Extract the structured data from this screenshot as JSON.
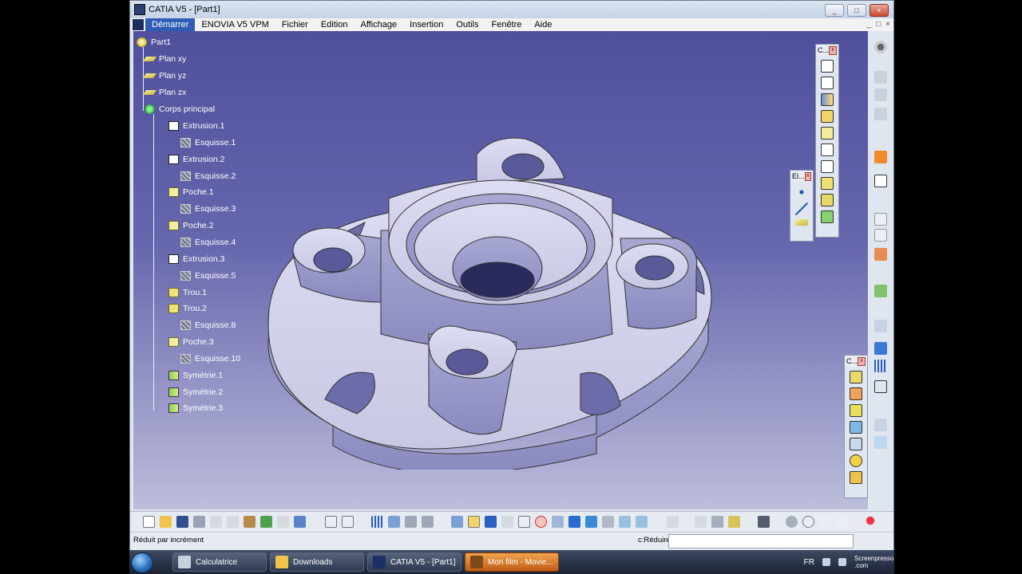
{
  "window": {
    "title": "CATIA V5 - [Part1]"
  },
  "menu": {
    "items": [
      "Démarrer",
      "ENOVIA V5 VPM",
      "Fichier",
      "Edition",
      "Affichage",
      "Insertion",
      "Outils",
      "Fenêtre",
      "Aide"
    ],
    "right_controls": [
      "_",
      "□",
      "×"
    ]
  },
  "tree": {
    "root": "Part1",
    "items": [
      {
        "label": "Plan xy",
        "icon": "plane-icon"
      },
      {
        "label": "Plan yz",
        "icon": "plane-icon"
      },
      {
        "label": "Plan zx",
        "icon": "plane-icon"
      },
      {
        "label": "Corps principal",
        "icon": "body-icon"
      },
      {
        "label": "Extrusion.1",
        "icon": "pad-icon"
      },
      {
        "label": "Esquisse.1",
        "icon": "sketch-icon"
      },
      {
        "label": "Extrusion.2",
        "icon": "pad-icon"
      },
      {
        "label": "Esquisse.2",
        "icon": "sketch-icon"
      },
      {
        "label": "Poche.1",
        "icon": "pocket-icon"
      },
      {
        "label": "Esquisse.3",
        "icon": "sketch-icon"
      },
      {
        "label": "Poche.2",
        "icon": "pocket-icon"
      },
      {
        "label": "Esquisse.4",
        "icon": "sketch-icon"
      },
      {
        "label": "Extrusion.3",
        "icon": "pad-icon"
      },
      {
        "label": "Esquisse.5",
        "icon": "sketch-icon"
      },
      {
        "label": "Trou.1",
        "icon": "hole-icon"
      },
      {
        "label": "Trou.2",
        "icon": "hole-icon"
      },
      {
        "label": "Esquisse.8",
        "icon": "sketch-icon"
      },
      {
        "label": "Poche.3",
        "icon": "pocket-icon"
      },
      {
        "label": "Esquisse.10",
        "icon": "sketch-icon"
      },
      {
        "label": "Symétrie.1",
        "icon": "symmetry-icon"
      },
      {
        "label": "Symétrie.2",
        "icon": "symmetry-icon"
      },
      {
        "label": "Symétrie.3",
        "icon": "symmetry-icon"
      }
    ]
  },
  "floating_toolbars": {
    "toolbar1_title": "C...",
    "toolbar2_title": "El...",
    "toolbar3_title": "C..."
  },
  "status": {
    "message": "Réduit par incrément",
    "command_label": "c:Réduire",
    "command_value": ""
  },
  "taskbar": {
    "tasks": [
      "Calculatrice",
      "Downloads",
      "CATIA V5 - [Part1]",
      "Mon film - Movie..."
    ],
    "language": "FR",
    "watermark": "Screenpresso .com"
  },
  "colors": {
    "viewport_top": "#4f4f9c",
    "viewport_bottom": "#bdbddb",
    "part_fill": "#dcdcf2",
    "menu_active": "#2f5db4"
  }
}
